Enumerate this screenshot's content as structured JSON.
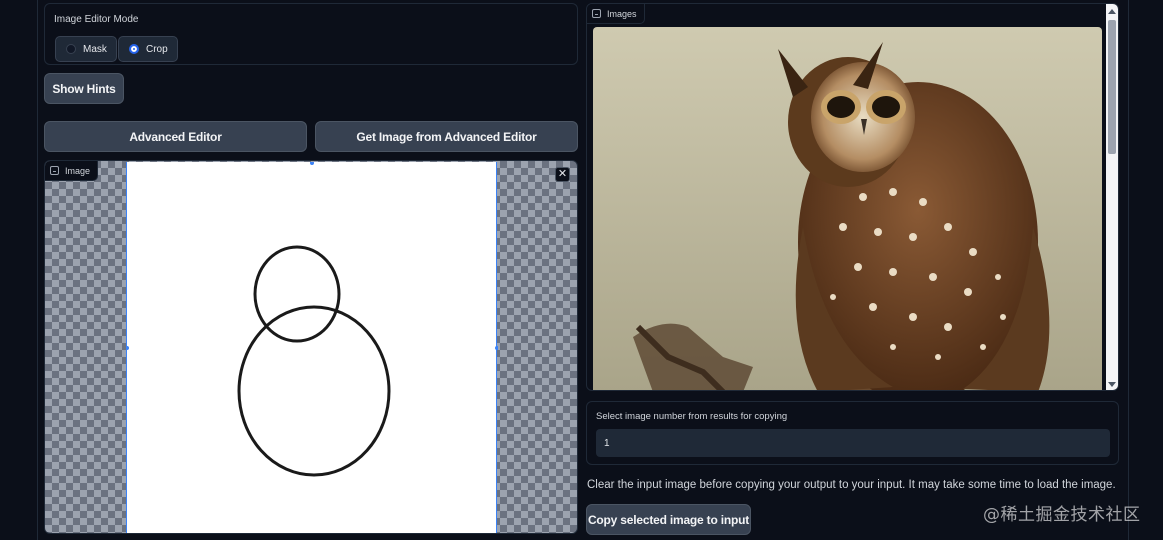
{
  "editor_mode": {
    "title": "Image Editor Mode",
    "options": [
      {
        "label": "Mask",
        "selected": false
      },
      {
        "label": "Crop",
        "selected": true
      }
    ]
  },
  "buttons": {
    "show_hints": "Show Hints",
    "advanced_editor": "Advanced Editor",
    "get_image": "Get Image from Advanced Editor",
    "copy_selected": "Copy selected image to input"
  },
  "image_input": {
    "label": "Image",
    "close_glyph": "✕"
  },
  "gallery": {
    "label": "Images"
  },
  "select_image": {
    "label": "Select image number from results for copying",
    "value": "1"
  },
  "note": "Clear the input image before copying your output to your input. It may take some time to load the image.",
  "watermark": "@稀土掘金技术社区",
  "colors": {
    "background": "#0b0f19",
    "button": "#374151",
    "accent": "#2563eb"
  }
}
